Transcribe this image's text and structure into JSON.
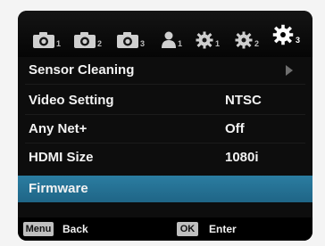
{
  "tabs": [
    {
      "icon": "camera-icon",
      "sub": "1"
    },
    {
      "icon": "camera-icon",
      "sub": "2"
    },
    {
      "icon": "camera-icon",
      "sub": "3"
    },
    {
      "icon": "person-icon",
      "sub": "1"
    },
    {
      "icon": "wrench-icon",
      "sub": "1"
    },
    {
      "icon": "wrench-icon",
      "sub": "2"
    },
    {
      "icon": "wrench-icon",
      "sub": "3"
    }
  ],
  "menu": {
    "items": [
      {
        "label": "Sensor Cleaning",
        "value": ""
      },
      {
        "label": "Video Setting",
        "value": "NTSC"
      },
      {
        "label": "Any Net+",
        "value": "Off"
      },
      {
        "label": "HDMI Size",
        "value": "1080i"
      },
      {
        "label": "Firmware",
        "value": ""
      }
    ],
    "selected_label": "Firmware"
  },
  "footer": {
    "menu_key": "Menu",
    "back_label": "Back",
    "ok_key": "OK",
    "enter_label": "Enter"
  },
  "colors": {
    "selected_row": "#2278a0",
    "background": "#000000"
  }
}
